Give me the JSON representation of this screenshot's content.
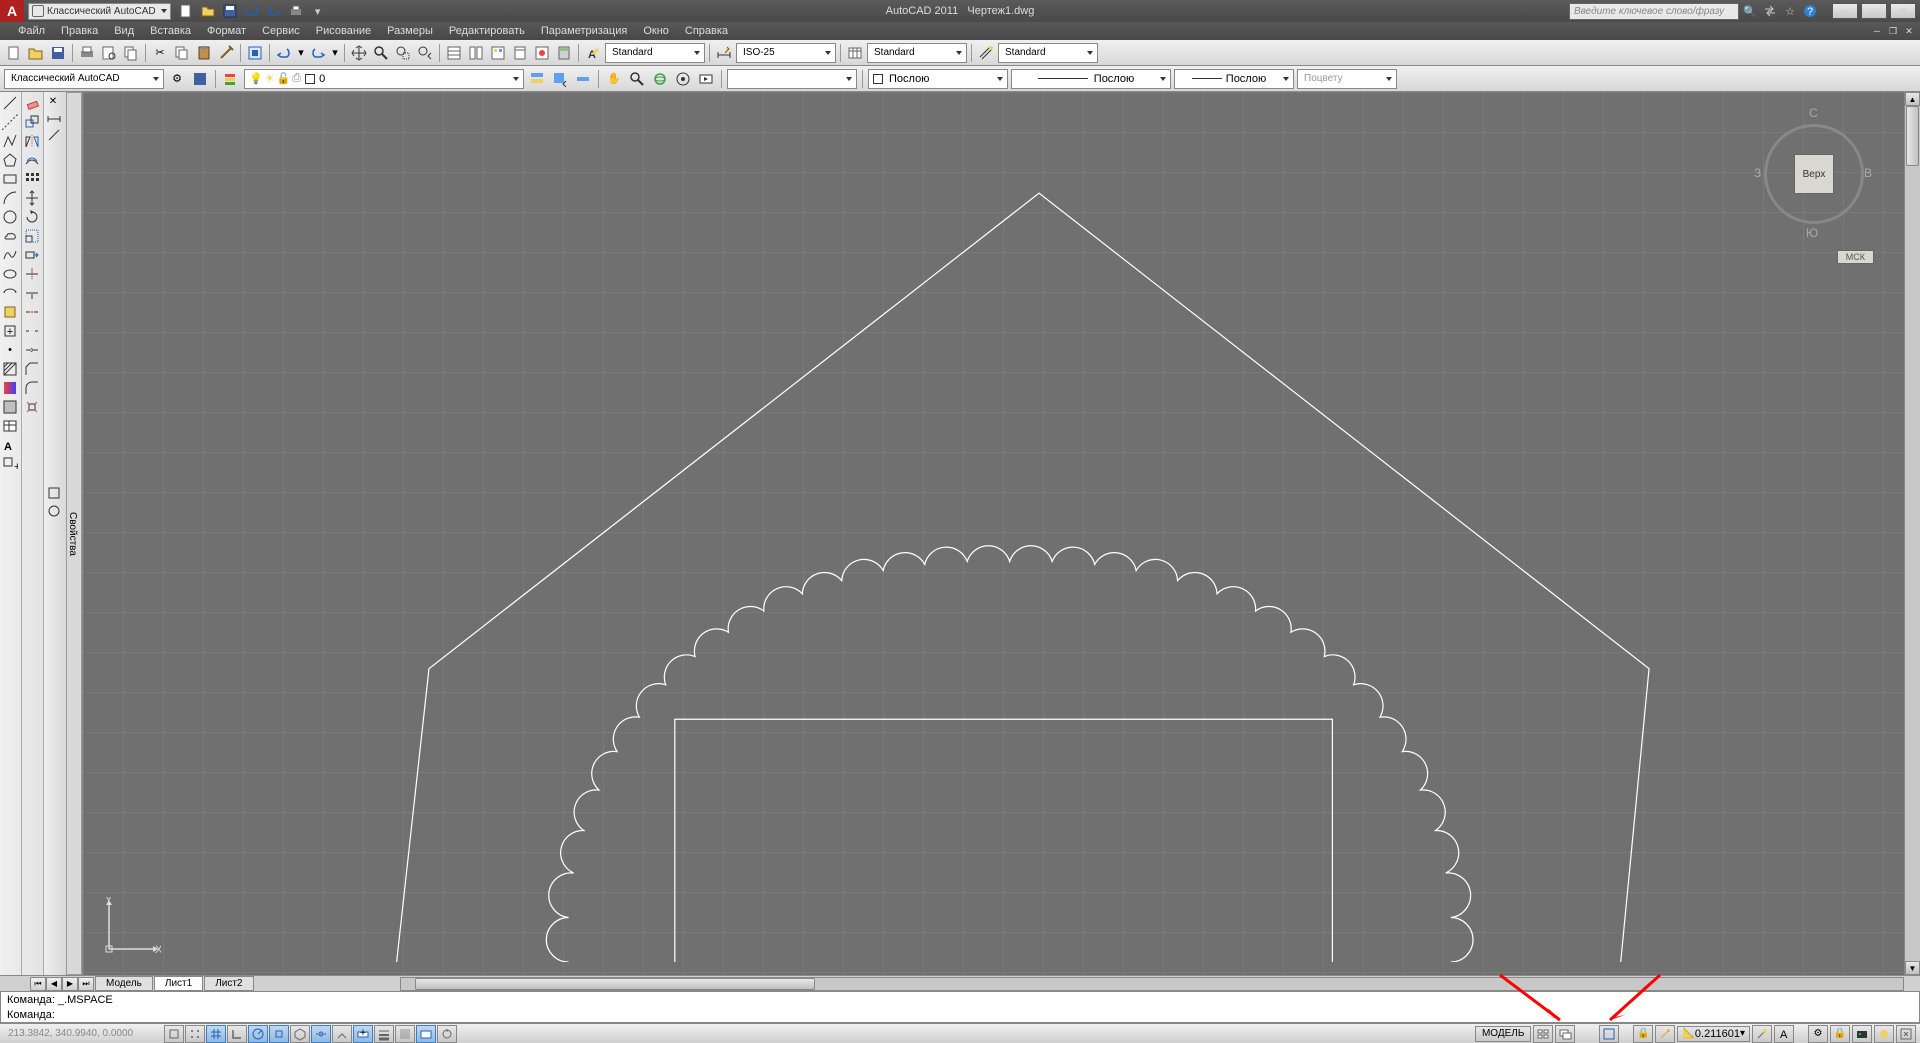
{
  "title": {
    "app": "AutoCAD 2011",
    "doc": "Чертеж1.dwg"
  },
  "workspace": "Классический AutoCAD",
  "search_placeholder": "Введите ключевое слово/фразу",
  "menus": [
    "Файл",
    "Правка",
    "Вид",
    "Вставка",
    "Формат",
    "Сервис",
    "Рисование",
    "Размеры",
    "Редактировать",
    "Параметризация",
    "Окно",
    "Справка"
  ],
  "toolbar1": {
    "textstyle": "Standard",
    "dimstyle": "ISO-25",
    "tablestyle": "Standard",
    "mlstyle": "Standard"
  },
  "toolbar2": {
    "workspace": "Классический AutoCAD",
    "layer": "0",
    "color": "Послою",
    "linetype": "Послою",
    "lineweight": "Послою",
    "plotstyle": "Поцвету"
  },
  "tabs": {
    "model": "Модель",
    "layouts": [
      "Лист1",
      "Лист2"
    ]
  },
  "cmd": {
    "prev": "Команда: _.MSPACE",
    "prompt": "Команда:"
  },
  "viewcube": {
    "face": "Bepx",
    "n": "С",
    "s": "Ю",
    "e": "В",
    "w": "З",
    "ucs": "МСК"
  },
  "props_label": "Свойства",
  "status": {
    "coords": "213.3842, 340.9940, 0.0000",
    "model": "МОДЕЛЬ",
    "scale": "0.211601"
  }
}
